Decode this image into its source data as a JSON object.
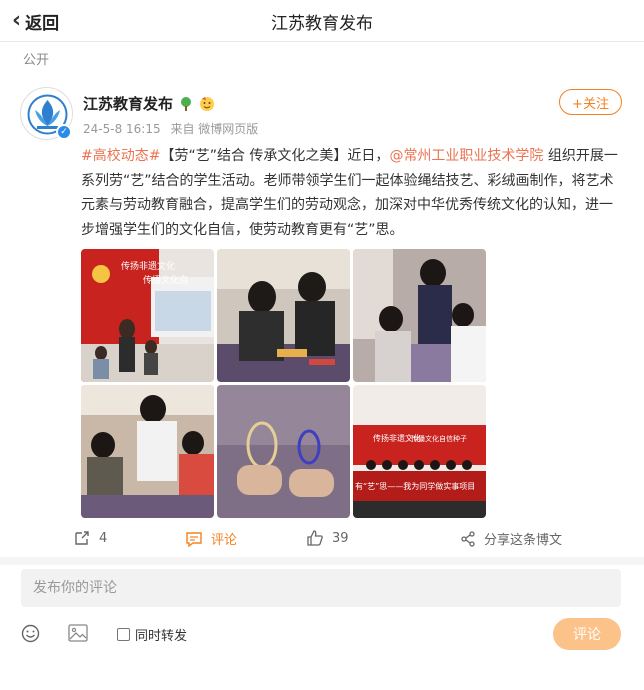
{
  "header": {
    "back_label": "返回",
    "title": "江苏教育发布"
  },
  "post": {
    "visibility": "公开",
    "author": "江苏教育发布",
    "timestamp": "24-5-8 16:15",
    "source": "来自 微博网页版",
    "follow_label": "+关注",
    "hashtag": "#高校动态#",
    "text_1": "【劳“艺”结合 传承文化之美】近日，",
    "mention": "@常州工业职业技术学院",
    "text_2": " 组织开展一系列劳“艺”结合的学生活动。老师带领学生们一起体验绳结技艺、彩绒画制作，将艺术元素与劳动教育融合，提高学生们的劳动观念，加深对中华优秀传统文化的认知，进一步增强学生们的文化自信，使劳动教育更有“艺”思。",
    "image_captions": {
      "banner_1a": "传扬非遗文化",
      "banner_1b": "传播文化自",
      "banner_6a": "传扬非遗文化",
      "banner_6b": "传播文化自信种子",
      "banner_6c": "有“艺”思——我为同学做实事项目"
    }
  },
  "actions": {
    "repost_count": "4",
    "comment_label": "评论",
    "like_count": "39",
    "share_label": "分享这条博文"
  },
  "composer": {
    "placeholder": "发布你的评论",
    "repost_label": "同时转发",
    "submit_label": "评论"
  },
  "colors": {
    "accent": "#f5811f",
    "link": "#eb7350",
    "verified": "#2b8ce8",
    "submit_bg": "#fbc28a"
  }
}
